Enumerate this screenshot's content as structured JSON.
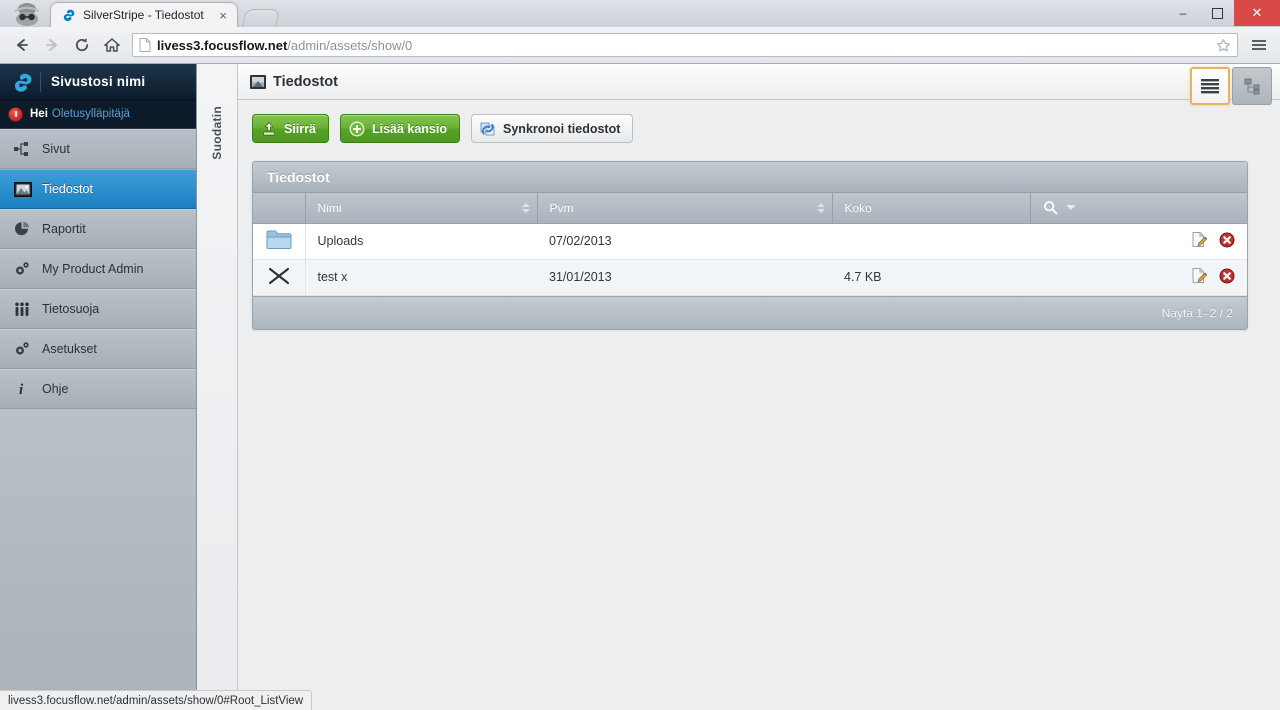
{
  "browser": {
    "incognito_icon": "incognito-person-icon",
    "tab": {
      "favicon": "silverstripe-logo-icon",
      "title": "SilverStripe - Tiedostot",
      "close_label": "×"
    },
    "newtab_label": "",
    "window_controls": {
      "minimize": "–",
      "maximize": "☐",
      "close": "✕"
    },
    "nav": {
      "back": "←",
      "forward": "→",
      "reload": "↻",
      "home": "⌂"
    },
    "omnibox": {
      "page_icon": "page-document-icon",
      "url_domain": "livess3.focusflow.net",
      "url_path": "/admin/assets/show/0",
      "star_icon": "bookmark-star-icon"
    },
    "menu_icon": "hamburger-menu-icon",
    "statusbar_url": "livess3.focusflow.net/admin/assets/show/0#Root_ListView"
  },
  "cms": {
    "logo": {
      "mark": "silverstripe-mark-icon",
      "site_name": "Sivustosi nimi"
    },
    "profile": {
      "power_icon": "logout-power-icon",
      "greeting": "Hei",
      "username": "Oletusylläpitäjä"
    },
    "menu_items": [
      {
        "label": "Sivut",
        "icon": "sitemap-icon",
        "active": false
      },
      {
        "label": "Tiedostot",
        "icon": "image-file-icon",
        "active": true
      },
      {
        "label": "Raportit",
        "icon": "pie-chart-icon",
        "active": false
      },
      {
        "label": "My Product Admin",
        "icon": "gears-icon",
        "active": false
      },
      {
        "label": "Tietosuoja",
        "icon": "people-group-icon",
        "active": false
      },
      {
        "label": "Asetukset",
        "icon": "gears-icon",
        "active": false
      },
      {
        "label": "Ohje",
        "icon": "info-italic-icon",
        "active": false
      }
    ],
    "filter_rail_label": "Suodatin",
    "header": {
      "icon": "image-file-icon",
      "title": "Tiedostot"
    },
    "view_toggle": {
      "list_view": "list-view-icon",
      "tree_view": "tree-view-icon"
    },
    "buttons": [
      {
        "label": "Siirrä",
        "icon": "upload-icon",
        "style": "green"
      },
      {
        "label": "Lisää kansio",
        "icon": "plus-circle-icon",
        "style": "green"
      },
      {
        "label": "Synkronoi tiedostot",
        "icon": "sync-refresh-icon",
        "style": "grey"
      }
    ],
    "grid": {
      "title": "Tiedostot",
      "columns": [
        {
          "key": "icon",
          "label": "",
          "sortable": false
        },
        {
          "key": "name",
          "label": "Nimi",
          "sortable": true
        },
        {
          "key": "date",
          "label": "Pvm",
          "sortable": true
        },
        {
          "key": "size",
          "label": "Koko",
          "sortable": true
        },
        {
          "key": "search",
          "label": "",
          "sortable": false,
          "icon": "search-magnifier-icon"
        }
      ],
      "rows": [
        {
          "icon": "folder-icon",
          "name": "Uploads",
          "date": "07/02/2013",
          "size": "",
          "edit_icon": "edit-pencil-icon",
          "delete_icon": "delete-circle-icon"
        },
        {
          "icon": "broken-file-icon",
          "name": "test x",
          "date": "31/01/2013",
          "size": "4.7 KB",
          "edit_icon": "edit-pencil-icon",
          "delete_icon": "delete-circle-icon"
        }
      ],
      "footer_label": "Näytä 1–2 / 2"
    }
  },
  "colors": {
    "accent_blue": "#1c7fc0",
    "green_button": "#57a226",
    "active_border": "#e8b25e",
    "link_blue": "#5b9fd4",
    "close_red": "#d84a4a"
  }
}
